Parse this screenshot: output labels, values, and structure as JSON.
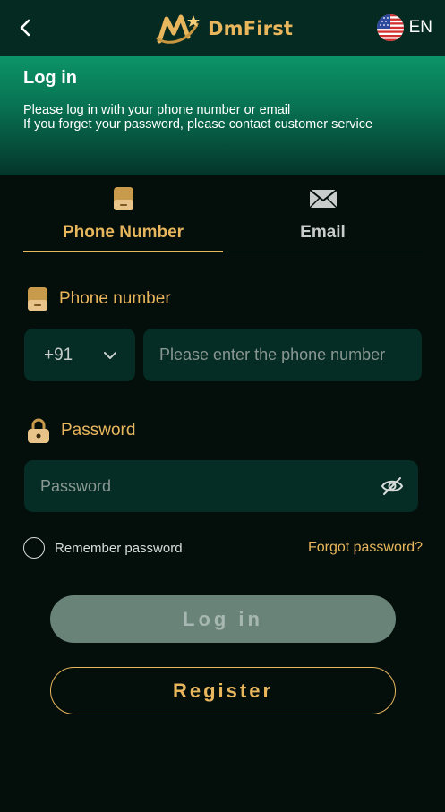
{
  "header": {
    "brand_name": "DmFirst",
    "language": "EN"
  },
  "banner": {
    "title": "Log in",
    "line1": "Please log in with your phone number or email",
    "line2": "If you forget your password, please contact customer service"
  },
  "tabs": [
    {
      "label": "Phone Number",
      "icon": "phone-icon",
      "active": true
    },
    {
      "label": "Email",
      "icon": "envelope-icon",
      "active": false
    }
  ],
  "phone_field": {
    "label": "Phone number",
    "country_code": "+91",
    "placeholder": "Please enter the phone number",
    "value": ""
  },
  "password_field": {
    "label": "Password",
    "placeholder": "Password",
    "value": ""
  },
  "remember_label": "Remember password",
  "forgot_label": "Forgot password?",
  "login_label": "Log in",
  "register_label": "Register",
  "colors": {
    "accent": "#e8b65c",
    "background": "#040f0c",
    "input_bg": "#052d25",
    "banner": "#0c9468"
  }
}
